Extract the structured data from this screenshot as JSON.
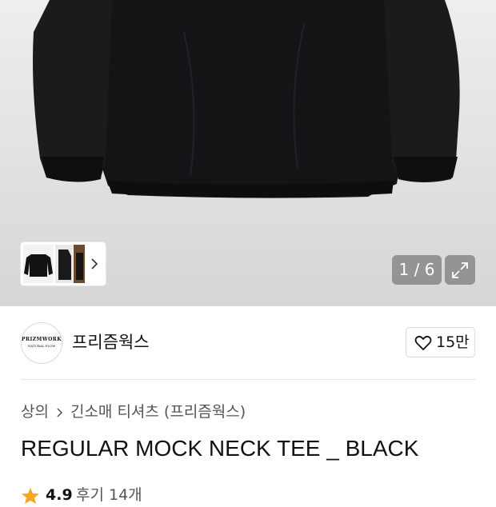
{
  "gallery": {
    "counter": "1 / 6",
    "expand_icon": "expand-arrows-icon",
    "thumbnail_next_icon": "chevron-right-icon"
  },
  "store": {
    "logo_text": "PRIZMWORKS",
    "logo_subtext": "NATURAL FLOW",
    "name": "프리즘웍스",
    "like_count": "15만",
    "like_icon": "heart-outline-icon"
  },
  "breadcrumb": {
    "items": [
      "상의",
      "긴소매 티셔츠 (프리즘웍스)"
    ],
    "separator_icon": "chevron-right-icon"
  },
  "product": {
    "title": "REGULAR MOCK NECK TEE _ BLACK",
    "rating": "4.9",
    "reviews": "후기 14개",
    "star_color": "#f5a623"
  }
}
